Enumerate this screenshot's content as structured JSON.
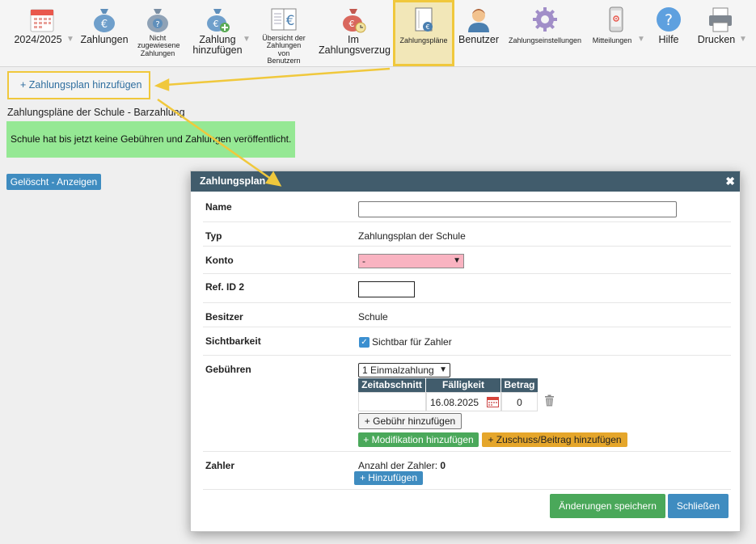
{
  "toolbar": {
    "school_year": "2024/2025",
    "payments": "Zahlungen",
    "unassigned": "Nicht zugewiesene Zahlungen",
    "add_payment": "Zahlung hinzufügen",
    "overview": "Übersicht der Zahlungen von Benutzern",
    "overdue": "Im Zahlungsverzug",
    "payment_plans": "Zahlungspläne",
    "users": "Benutzer",
    "payment_settings": "Zahlungseinstellungen",
    "messages": "Mitteilungen",
    "help": "Hilfe",
    "print": "Drucken",
    "dropdown_arrow": "▼"
  },
  "page": {
    "add_plan_label": "+ Zahlungsplan hinzufügen",
    "heading": "Zahlungspläne der Schule - Barzahlung",
    "notice": "Schule hat bis jetzt keine Gebühren und Zahlungen veröffentlicht.",
    "deleted_button": "Gelöscht - Anzeigen"
  },
  "modal": {
    "title": "Zahlungsplan",
    "close_glyph": "✖",
    "fields": {
      "name_label": "Name",
      "name_value": "",
      "type_label": "Typ",
      "type_value": "Zahlungsplan der Schule",
      "account_label": "Konto",
      "account_value": "-",
      "ref_label": "Ref. ID 2",
      "ref_value": "",
      "owner_label": "Besitzer",
      "owner_value": "Schule",
      "visibility_label": "Sichtbarkeit",
      "visibility_option": "Sichtbar für Zahler",
      "visibility_checked": true,
      "fees_label": "Gebühren",
      "fees_select_value": "1 Einmalzahlung",
      "payers_label": "Zahler",
      "payers_count_label": "Anzahl der Zahler:",
      "payers_count_value": "0"
    },
    "fees_table": {
      "headers": [
        "Zeitabschnitt",
        "Fälligkeit",
        "Betrag"
      ],
      "rows": [
        {
          "period": "",
          "due_date": "16.08.2025",
          "amount": "0"
        }
      ]
    },
    "buttons": {
      "add_fee": "+ Gebühr hinzufügen",
      "add_modification": "+ Modifikation hinzufügen",
      "add_subsidy": "+ Zuschuss/Beitrag hinzufügen",
      "add_payer": "+ Hinzufügen",
      "save": "Änderungen speichern",
      "close": "Schließen"
    }
  },
  "colors": {
    "highlight": "#f0c83c",
    "header_bg": "#415c6c",
    "primary_blue": "#3f8cc0",
    "success_green": "#4aa85a",
    "warning_orange": "#e5a62b",
    "notice_green": "#95e894",
    "invalid_pink": "#f9b3c1"
  },
  "icons": {
    "calendar": "calendar-icon",
    "euro_bag": "money-bag-euro-icon",
    "question_bag": "money-bag-question-icon",
    "add_bag": "money-bag-plus-icon",
    "ledger": "ledger-euro-icon",
    "overdue_bag": "money-bag-clock-icon",
    "plan_doc": "document-coin-icon",
    "user": "user-icon",
    "gear": "gear-icon",
    "phone": "phone-icon",
    "help": "help-icon",
    "printer": "printer-icon",
    "trash": "trash-icon"
  }
}
